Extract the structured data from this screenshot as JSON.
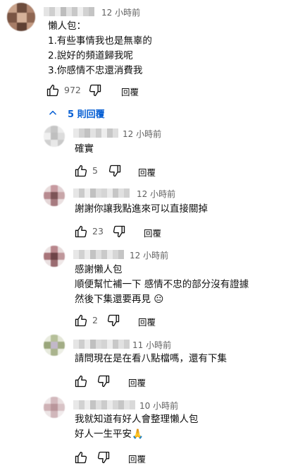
{
  "comments": [
    {
      "time": "12 小時前",
      "lines": [
        "懶人包：",
        "1.有些事情我也是無辜的",
        "2.說好的頻道歸我呢",
        "3.你感情不忠還消費我"
      ],
      "likes": "972",
      "reply_label": "回覆"
    },
    {
      "time": "12 小時前",
      "lines": [
        "確實"
      ],
      "likes": "5",
      "reply_label": "回覆"
    },
    {
      "time": "12 小時前",
      "lines": [
        "謝謝你讓我點進來可以直接關掉"
      ],
      "likes": "23",
      "reply_label": "回覆"
    },
    {
      "time": "12 小時前",
      "lines": [
        "感謝懶人包",
        "順便幫忙補一下 感情不忠的部分沒有證據",
        "然後下集還要再見 😐"
      ],
      "likes": "2",
      "reply_label": "回覆"
    },
    {
      "time": "11 小時前",
      "lines": [
        "請問現在是在看八點檔嗎，還有下集"
      ],
      "likes": "",
      "reply_label": "回覆"
    },
    {
      "time": "10 小時前",
      "lines": [
        "我就知道有好人會整理懶人包",
        "好人一生平安🙏"
      ],
      "likes": "",
      "reply_label": "回覆"
    }
  ],
  "replies_toggle": {
    "label": "5 則回覆"
  },
  "icons": {
    "like": "thumb-up-icon",
    "dislike": "thumb-down-icon",
    "toggle": "chevron-up-icon"
  },
  "colors": {
    "link_blue": "#065fd4",
    "secondary_text": "#606060",
    "primary_text": "#0f0f0f"
  }
}
